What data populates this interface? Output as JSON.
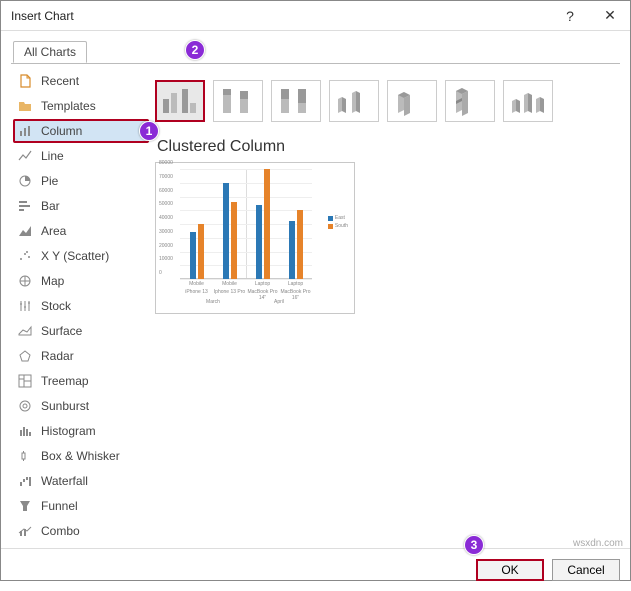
{
  "dialog": {
    "title": "Insert Chart",
    "help": "?",
    "close": "✕"
  },
  "tabs": {
    "all_charts": "All Charts"
  },
  "sidebar": {
    "items": [
      {
        "label": "Recent"
      },
      {
        "label": "Templates"
      },
      {
        "label": "Column"
      },
      {
        "label": "Line"
      },
      {
        "label": "Pie"
      },
      {
        "label": "Bar"
      },
      {
        "label": "Area"
      },
      {
        "label": "X Y (Scatter)"
      },
      {
        "label": "Map"
      },
      {
        "label": "Stock"
      },
      {
        "label": "Surface"
      },
      {
        "label": "Radar"
      },
      {
        "label": "Treemap"
      },
      {
        "label": "Sunburst"
      },
      {
        "label": "Histogram"
      },
      {
        "label": "Box & Whisker"
      },
      {
        "label": "Waterfall"
      },
      {
        "label": "Funnel"
      },
      {
        "label": "Combo"
      }
    ]
  },
  "preview": {
    "title": "Clustered Column"
  },
  "legend": {
    "east": "East",
    "south": "South"
  },
  "buttons": {
    "ok": "OK",
    "cancel": "Cancel"
  },
  "badges": {
    "b1": "1",
    "b2": "2",
    "b3": "3"
  },
  "watermark": "wsxdn.com",
  "chart_data": {
    "type": "bar",
    "title": "Clustered Column",
    "ylim": [
      0,
      80000
    ],
    "yticks": [
      0,
      10000,
      20000,
      30000,
      40000,
      50000,
      60000,
      70000,
      80000
    ],
    "categories_top": [
      "Mobile",
      "Mobile",
      "Laptop",
      "Laptop"
    ],
    "categories_bottom": [
      "iPhone 13",
      "Iphone 13 Pro",
      "MacBook Pro 14\"",
      "MacBook Pro 16\""
    ],
    "group_labels": [
      "March",
      "April"
    ],
    "series": [
      {
        "name": "East",
        "color": "#2b78b5",
        "values": [
          34000,
          70000,
          54000,
          42000
        ]
      },
      {
        "name": "South",
        "color": "#e6832a",
        "values": [
          40000,
          56000,
          80000,
          50000
        ]
      }
    ]
  }
}
